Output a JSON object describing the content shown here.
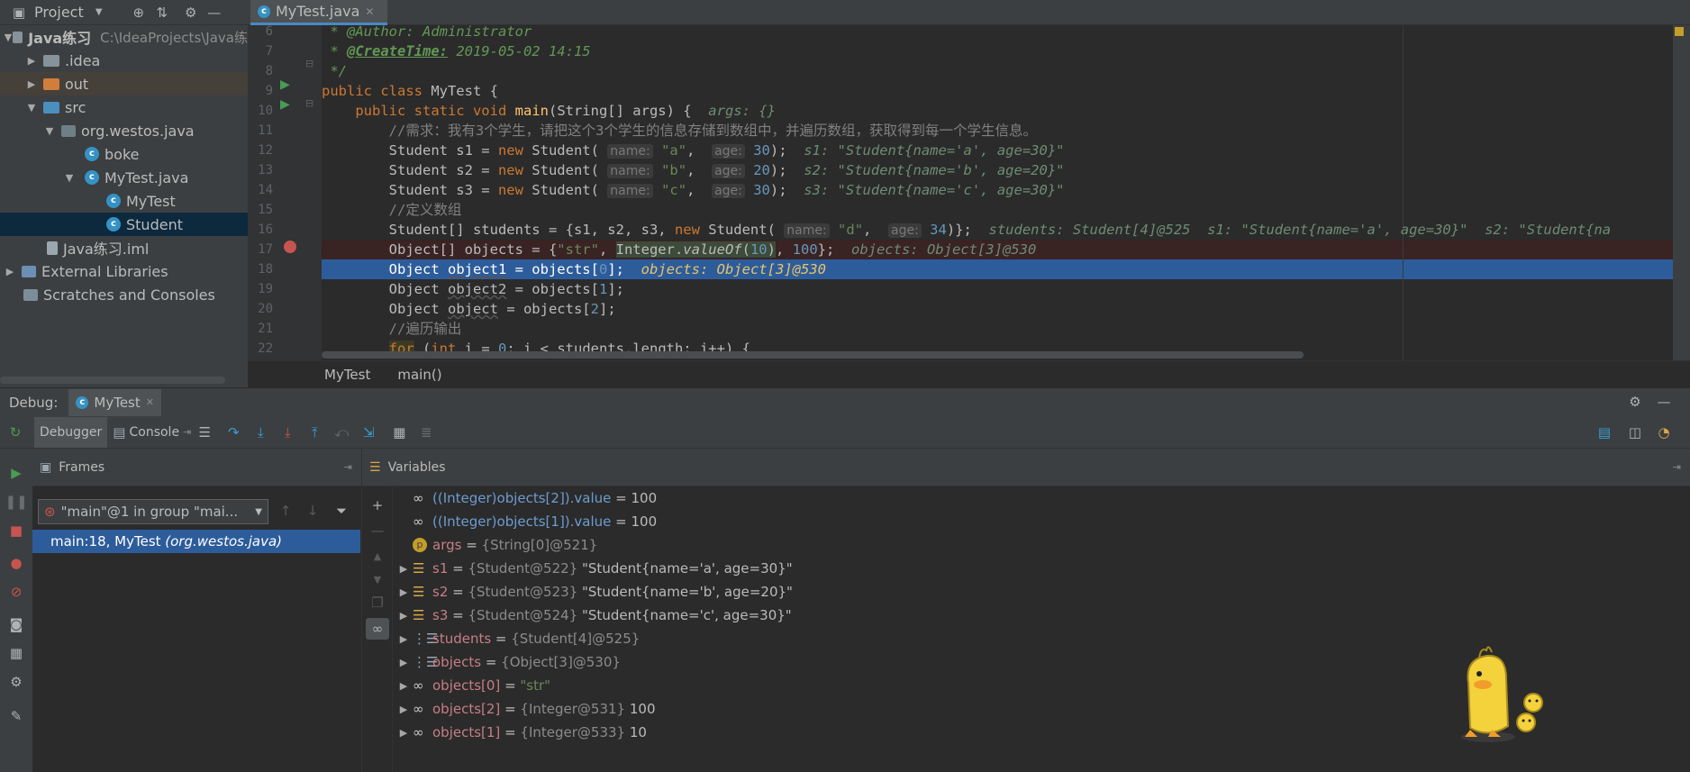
{
  "project": {
    "header_label": "Project",
    "tree": [
      {
        "label": "Java练习",
        "sub": "C:\\IdeaProjects\\Java练"
      },
      {
        "label": ".idea"
      },
      {
        "label": "out"
      },
      {
        "label": "src"
      },
      {
        "label": "org.westos.java"
      },
      {
        "label": "boke"
      },
      {
        "label": "MyTest.java"
      },
      {
        "label": "MyTest"
      },
      {
        "label": "Student"
      },
      {
        "label": "Java练习.iml"
      },
      {
        "label": "External Libraries"
      },
      {
        "label": "Scratches and Consoles"
      }
    ]
  },
  "editor": {
    "tab_label": "MyTest.java",
    "line_numbers": [
      "6",
      "7",
      "8",
      "9",
      "10",
      "11",
      "12",
      "13",
      "14",
      "15",
      "16",
      "17",
      "18",
      "19",
      "20",
      "21",
      "22"
    ],
    "lines": {
      "l6a": " * @Author: Administrator",
      "l7tag": "@CreateTime:",
      "l7val": " 2019-05-02 14:15",
      "l8": " */",
      "l11": "        //需求：我有3个学生，请把这个3个学生的信息存储到数组中，并遍历数组，获取得到每一个学生信息。",
      "l15": "        //定义数组",
      "l21": "        //遍历输出"
    },
    "hints": {
      "args": "args: {}",
      "s1": "s1: \"Student{name='a', age=30}\"",
      "s2": "s2: \"Student{name='b', age=20}\"",
      "s3": "s3: \"Student{name='c', age=30}\"",
      "students": "students: Student[4]@525  s1: \"Student{name='a', age=30}\"  s2: \"Student{na",
      "objects17": "objects: Object[3]@530",
      "objects18": "objects: Object[3]@530"
    },
    "breadcrumb": [
      "MyTest",
      "main()"
    ]
  },
  "debug": {
    "label": "Debug:",
    "config_tab": "MyTest",
    "debugger_tab": "Debugger",
    "console_tab": "Console",
    "frames_title": "Frames",
    "variables_title": "Variables",
    "thread_select": "\"main\"@1 in group \"mai...",
    "frame_name": "main:18, MyTest ",
    "frame_pkg": "(org.westos.java)",
    "variables": [
      {
        "name": "((Integer)objects[2]).value",
        "eq": " = ",
        "ref": "",
        "val": "100",
        "kind": "watch"
      },
      {
        "name": "((Integer)objects[1]).value",
        "eq": " = ",
        "ref": "",
        "val": "100",
        "kind": "watch"
      },
      {
        "name": "args",
        "eq": " = ",
        "ref": "{String[0]@521}",
        "val": "",
        "kind": "param"
      },
      {
        "name": "s1",
        "eq": " = ",
        "ref": "{Student@522}",
        "val": "\"Student{name='a', age=30}\"",
        "kind": "field"
      },
      {
        "name": "s2",
        "eq": " = ",
        "ref": "{Student@523}",
        "val": "\"Student{name='b', age=20}\"",
        "kind": "field"
      },
      {
        "name": "s3",
        "eq": " = ",
        "ref": "{Student@524}",
        "val": "\"Student{name='c', age=30}\"",
        "kind": "field"
      },
      {
        "name": "students",
        "eq": " = ",
        "ref": "{Student[4]@525}",
        "val": "",
        "kind": "array"
      },
      {
        "name": "objects",
        "eq": " = ",
        "ref": "{Object[3]@530}",
        "val": "",
        "kind": "array"
      },
      {
        "name": "objects[0]",
        "eq": " = ",
        "ref": "",
        "val": "\"str\"",
        "kind": "watchstr"
      },
      {
        "name": "objects[2]",
        "eq": " = ",
        "ref": "{Integer@531}",
        "val": "100",
        "kind": "watch"
      },
      {
        "name": "objects[1]",
        "eq": " = ",
        "ref": "{Integer@533}",
        "val": "10",
        "kind": "watch"
      }
    ]
  }
}
